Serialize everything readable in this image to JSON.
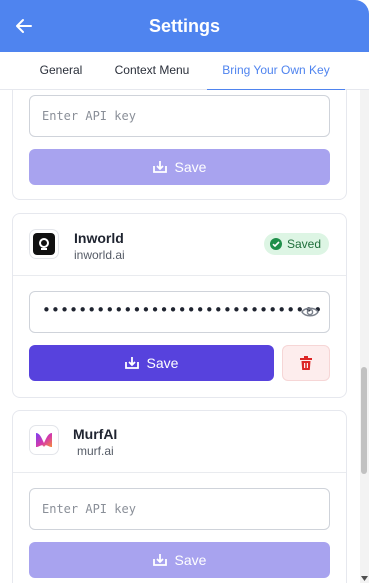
{
  "header": {
    "title": "Settings",
    "back_icon": "arrow-left-icon"
  },
  "tabs": [
    {
      "label": "General",
      "active": false
    },
    {
      "label": "Context Menu",
      "active": false
    },
    {
      "label": "Bring Your Own Key",
      "active": true
    }
  ],
  "cards": {
    "top": {
      "input_placeholder": "Enter API key",
      "save_label": "Save",
      "save_enabled": false
    },
    "inworld": {
      "name": "Inworld",
      "url": "inworld.ai",
      "badge": "Saved",
      "input_value": "•••••••••••••••••••••••••••••••",
      "save_label": "Save",
      "save_enabled": true,
      "delete_icon": "trash-icon"
    },
    "murf": {
      "name": "MurfAI",
      "url": "murf.ai",
      "input_placeholder": "Enter API key",
      "save_label": "Save",
      "save_enabled": false
    }
  },
  "colors": {
    "header": "#4f84ef",
    "primary": "#5742dd",
    "disabled": "#a8a3ef",
    "badge_bg": "#ddf5e4",
    "badge_text": "#1f6f3b",
    "delete": "#dc2626"
  }
}
